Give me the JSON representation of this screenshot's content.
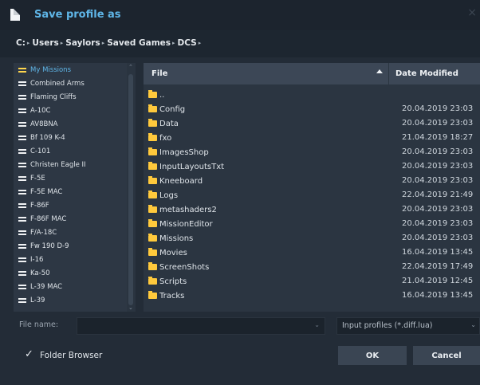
{
  "dialog": {
    "title": "Save profile as",
    "close": "×"
  },
  "path": {
    "crumbs": [
      "C:",
      "Users",
      "Saylors",
      "Saved Games",
      "DCS"
    ],
    "separator": "▸"
  },
  "sidebar": {
    "items": [
      {
        "label": "My Missions",
        "selected": true
      },
      {
        "label": "Combined Arms"
      },
      {
        "label": "Flaming Cliffs"
      },
      {
        "label": "A-10C"
      },
      {
        "label": "AV8BNA"
      },
      {
        "label": "Bf 109 K-4"
      },
      {
        "label": "C-101"
      },
      {
        "label": "Christen Eagle II"
      },
      {
        "label": "F-5E"
      },
      {
        "label": "F-5E MAC"
      },
      {
        "label": "F-86F"
      },
      {
        "label": "F-86F MAC"
      },
      {
        "label": "F/A-18C"
      },
      {
        "label": "Fw 190 D-9"
      },
      {
        "label": "I-16"
      },
      {
        "label": "Ka-50"
      },
      {
        "label": "L-39 MAC"
      },
      {
        "label": "L-39"
      }
    ],
    "scroll_up": "⌃",
    "scroll_down": "⌄"
  },
  "files": {
    "col_file": "File",
    "col_date": "Date Modified",
    "rows": [
      {
        "name": "..",
        "date": ""
      },
      {
        "name": "Config",
        "date": "20.04.2019 23:03"
      },
      {
        "name": "Data",
        "date": "20.04.2019 23:03"
      },
      {
        "name": "fxo",
        "date": "21.04.2019 18:27"
      },
      {
        "name": "ImagesShop",
        "date": "20.04.2019 23:03"
      },
      {
        "name": "InputLayoutsTxt",
        "date": "20.04.2019 23:03"
      },
      {
        "name": "Kneeboard",
        "date": "20.04.2019 23:03"
      },
      {
        "name": "Logs",
        "date": "22.04.2019 21:49"
      },
      {
        "name": "metashaders2",
        "date": "20.04.2019 23:03"
      },
      {
        "name": "MissionEditor",
        "date": "20.04.2019 23:03"
      },
      {
        "name": "Missions",
        "date": "20.04.2019 23:03"
      },
      {
        "name": "Movies",
        "date": "16.04.2019 13:45"
      },
      {
        "name": "ScreenShots",
        "date": "22.04.2019 17:49"
      },
      {
        "name": "Scripts",
        "date": "21.04.2019 12:45"
      },
      {
        "name": "Tracks",
        "date": "16.04.2019 13:45"
      }
    ]
  },
  "footer": {
    "file_name_label": "File name:",
    "file_name_value": "",
    "file_type_value": "Input profiles (*.diff.lua)",
    "chevron": "⌄",
    "folder_browser_label": "Folder Browser",
    "folder_browser_checked": true,
    "check_glyph": "✓",
    "ok_label": "OK",
    "cancel_label": "Cancel"
  }
}
